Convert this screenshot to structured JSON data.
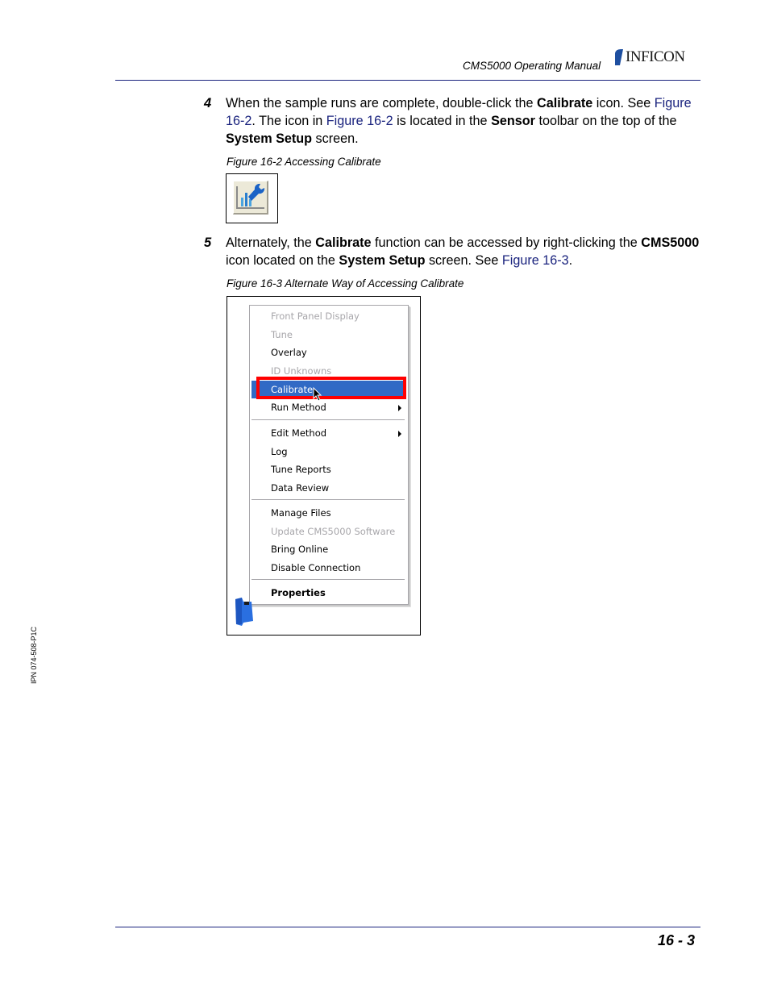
{
  "header": {
    "title": "CMS5000 Operating Manual",
    "logo_text": "INFICON"
  },
  "steps": [
    {
      "number": "4",
      "parts": {
        "t1": "When the sample runs are complete, double-click the ",
        "b1": "Calibrate",
        "t2": " icon. See ",
        "l1": "Figure 16-2",
        "t3": ". The icon in ",
        "l2": "Figure 16-2",
        "t4": " is located in the ",
        "b2": "Sensor",
        "t5": " toolbar on the top of the ",
        "b3": "System Setup",
        "t6": " screen."
      }
    },
    {
      "number": "5",
      "parts": {
        "t1": "Alternately, the ",
        "b1": "Calibrate",
        "t2": " function can be accessed by right-clicking the ",
        "b2": "CMS5000",
        "t3": " icon located on the ",
        "b3": "System Setup",
        "t4": " screen. See ",
        "l1": "Figure 16-3",
        "t5": "."
      }
    }
  ],
  "figures": {
    "fig2": {
      "caption": "Figure 16-2  Accessing Calibrate",
      "icon": "calibrate-icon"
    },
    "fig3": {
      "caption": "Figure 16-3  Alternate Way of Accessing Calibrate"
    }
  },
  "context_menu": {
    "items": [
      {
        "label": "Front Panel Display",
        "disabled": true
      },
      {
        "label": "Tune",
        "disabled": true
      },
      {
        "label": "Overlay",
        "disabled": false
      },
      {
        "label": "ID Unknowns",
        "disabled": true
      },
      {
        "label": "Calibrate",
        "disabled": false,
        "selected": true
      },
      {
        "label": "Run Method",
        "disabled": false,
        "submenu": true
      },
      {
        "label": "Edit Method",
        "disabled": false,
        "submenu": true
      },
      {
        "label": "Log",
        "disabled": false
      },
      {
        "label": "Tune Reports",
        "disabled": false
      },
      {
        "label": "Data Review",
        "disabled": false
      },
      {
        "label": "Manage Files",
        "disabled": false
      },
      {
        "label": "Update CMS5000 Software",
        "disabled": true
      },
      {
        "label": "Bring Online",
        "disabled": false
      },
      {
        "label": "Disable Connection",
        "disabled": false
      },
      {
        "label": "Properties",
        "disabled": false,
        "bold": true
      }
    ]
  },
  "colors": {
    "link": "#1a237e",
    "highlight_border": "#ff0000",
    "menu_selected": "#316ac5"
  },
  "side_text": "IPN 074-508-P1C",
  "page_number": "16 - 3"
}
